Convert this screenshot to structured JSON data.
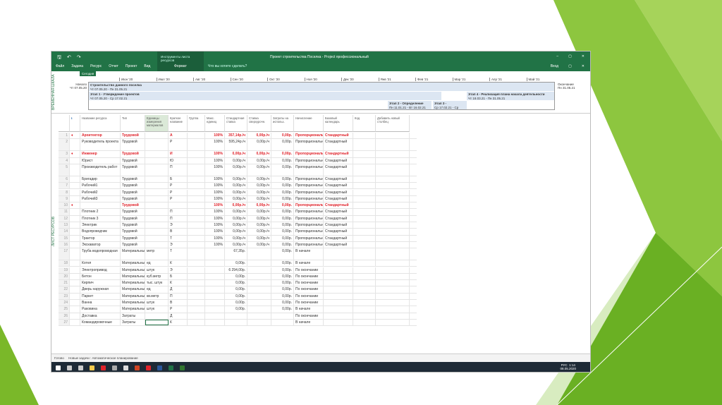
{
  "app": {
    "title": "Проект строительства Поселка - Project профессиональный",
    "context_tab_group": "Инструменты листа ресурсов",
    "context_tab": "Формат",
    "tell_me": "Что вы хотите сделать?",
    "sign_in": "Вход"
  },
  "menu": [
    "Файл",
    "Задача",
    "Ресурс",
    "Отчет",
    "Проект",
    "Вид"
  ],
  "timeline": {
    "label": "ВРЕМЕННАЯ ШКАЛА",
    "today": "Сегодня",
    "start_label": "Начало",
    "start_date": "Чт 07.05.20",
    "end_label": "Окончание",
    "end_date": "Пн 31.05.21",
    "months": [
      "Июн '20",
      "Июл '20",
      "Авг '20",
      "Сен '20",
      "Окт '20",
      "Ноя '20",
      "Дек '20",
      "Янв '21",
      "Фев '21",
      "Мар '21",
      "Апр '21",
      "Май '21"
    ],
    "bars": [
      {
        "name": "Строительство данного поселка",
        "dates": "Чт 07.05.20 - Пн 31.05.21"
      },
      {
        "name": "Этап 1 - Утверждение проектов",
        "dates": "Чт 07.05.20 - Ср 17.02.21"
      },
      {
        "name": "Этап 4 - Реализация плана начала деятельности",
        "dates": "Чт 18.03.21 - Пн 31.05.21"
      },
      {
        "name": "Этап 2 - Определение",
        "dates": "Пн 11.01.21 - Вт 16.02.21"
      },
      {
        "name": "Этап 3 -",
        "dates": "Ср 17.02.21 - Ср"
      }
    ]
  },
  "sheet_label": "ЛИСТ РЕСУРСОВ",
  "columns": [
    "",
    "Название ресурса",
    "Тип",
    "Единицы измерения материалов",
    "Краткое название",
    "Группа",
    "Макс. единиц",
    "Стандартная ставка",
    "Ставка сверхурочн.",
    "Затраты на использ.",
    "Начисление",
    "Базовый календарь",
    "Код",
    "Добавить новый столбец"
  ],
  "rows": [
    {
      "n": "1",
      "ind": true,
      "name": "Архитектор",
      "type": "Трудовой",
      "unit": "",
      "ini": "А",
      "max": "100%",
      "std": "357,14р./ч",
      "ovt": "0,00р./ч",
      "cost": "0,00р.",
      "acc": "Пропорционально",
      "cal": "Стандартный",
      "red": true
    },
    {
      "n": "2",
      "name": "Руководитель проекта",
      "type": "Трудовой",
      "unit": "",
      "ini": "Р",
      "max": "100%",
      "std": "595,24р./ч",
      "ovt": "0,00р./ч",
      "cost": "0,00р.",
      "acc": "Пропорционально",
      "cal": "Стандартный",
      "tall": true
    },
    {
      "n": "3",
      "ind": true,
      "name": "Инженер",
      "type": "Трудовой",
      "unit": "",
      "ini": "И",
      "max": "100%",
      "std": "0,00р./ч",
      "ovt": "0,00р./ч",
      "cost": "0,00р.",
      "acc": "Пропорционально",
      "cal": "Стандартный",
      "red": true
    },
    {
      "n": "4",
      "name": "Юрист",
      "type": "Трудовой",
      "unit": "",
      "ini": "Ю",
      "max": "100%",
      "std": "0,00р./ч",
      "ovt": "0,00р./ч",
      "cost": "0,00р.",
      "acc": "Пропорционально",
      "cal": "Стандартный"
    },
    {
      "n": "5",
      "name": "Производитель работ",
      "type": "Трудовой",
      "unit": "",
      "ini": "П",
      "max": "100%",
      "std": "0,00р./ч",
      "ovt": "0,00р./ч",
      "cost": "0,00р.",
      "acc": "Пропорционально",
      "cal": "Стандартный",
      "tall": true
    },
    {
      "n": "6",
      "name": "Бригадир",
      "type": "Трудовой",
      "unit": "",
      "ini": "Б",
      "max": "100%",
      "std": "0,00р./ч",
      "ovt": "0,00р./ч",
      "cost": "0,00р.",
      "acc": "Пропорционально",
      "cal": "Стандартный"
    },
    {
      "n": "7",
      "name": "Рабочий1",
      "type": "Трудовой",
      "unit": "",
      "ini": "Р",
      "max": "100%",
      "std": "0,00р./ч",
      "ovt": "0,00р./ч",
      "cost": "0,00р.",
      "acc": "Пропорционально",
      "cal": "Стандартный"
    },
    {
      "n": "8",
      "name": "Рабочий2",
      "type": "Трудовой",
      "unit": "",
      "ini": "Р",
      "max": "100%",
      "std": "0,00р./ч",
      "ovt": "0,00р./ч",
      "cost": "0,00р.",
      "acc": "Пропорционально",
      "cal": "Стандартный"
    },
    {
      "n": "9",
      "name": "Рабочий3",
      "type": "Трудовой",
      "unit": "",
      "ini": "Р",
      "max": "100%",
      "std": "0,00р./ч",
      "ovt": "0,00р./ч",
      "cost": "0,00р.",
      "acc": "Пропорционально",
      "cal": "Стандартный"
    },
    {
      "n": "10",
      "ind": true,
      "name": "",
      "type": "Трудовой",
      "unit": "",
      "ini": "",
      "max": "100%",
      "std": "0,00р./ч",
      "ovt": "0,00р./ч",
      "cost": "0,00р.",
      "acc": "Пропорционально",
      "cal": "Стандартный",
      "red": true
    },
    {
      "n": "11",
      "name": "Плотник 2",
      "type": "Трудовой",
      "unit": "",
      "ini": "П",
      "max": "100%",
      "std": "0,00р./ч",
      "ovt": "0,00р./ч",
      "cost": "0,00р.",
      "acc": "Пропорционально",
      "cal": "Стандартный"
    },
    {
      "n": "12",
      "name": "Плотник 3",
      "type": "Трудовой",
      "unit": "",
      "ini": "П",
      "max": "100%",
      "std": "0,00р./ч",
      "ovt": "0,00р./ч",
      "cost": "0,00р.",
      "acc": "Пропорционально",
      "cal": "Стандартный"
    },
    {
      "n": "13",
      "name": "Электрик",
      "type": "Трудовой",
      "unit": "",
      "ini": "Э",
      "max": "100%",
      "std": "0,00р./ч",
      "ovt": "0,00р./ч",
      "cost": "0,00р.",
      "acc": "Пропорционально",
      "cal": "Стандартный"
    },
    {
      "n": "14",
      "name": "Водопроводчик",
      "type": "Трудовой",
      "unit": "",
      "ini": "В",
      "max": "100%",
      "std": "0,00р./ч",
      "ovt": "0,00р./ч",
      "cost": "0,00р.",
      "acc": "Пропорционально",
      "cal": "Стандартный"
    },
    {
      "n": "15",
      "name": "Трактор",
      "type": "Трудовой",
      "unit": "",
      "ini": "Т",
      "max": "100%",
      "std": "0,00р./ч",
      "ovt": "0,00р./ч",
      "cost": "0,00р.",
      "acc": "Пропорционально",
      "cal": "Стандартный"
    },
    {
      "n": "16",
      "name": "Экскаватор",
      "type": "Трудовой",
      "unit": "",
      "ini": "Э",
      "max": "100%",
      "std": "0,00р./ч",
      "ovt": "0,00р./ч",
      "cost": "0,00р.",
      "acc": "Пропорционально",
      "cal": "Стандартный"
    },
    {
      "n": "17",
      "name": "Труба водопроводная",
      "type": "Материальный",
      "unit": "метр",
      "ini": "Т",
      "max": "",
      "std": "67,35р.",
      "ovt": "",
      "cost": "0,00р.",
      "acc": "В начале",
      "cal": "",
      "tall": true
    },
    {
      "n": "18",
      "name": "Котел",
      "type": "Материальный",
      "unit": "ед",
      "ini": "К",
      "max": "",
      "std": "0,00р.",
      "ovt": "",
      "cost": "0,00р.",
      "acc": "В начале",
      "cal": ""
    },
    {
      "n": "19",
      "name": "Электропривод",
      "type": "Материальный",
      "unit": "штук",
      "ini": "Э",
      "max": "",
      "std": "6 294,00р.",
      "ovt": "",
      "cost": "0,00р.",
      "acc": "По окончании",
      "cal": ""
    },
    {
      "n": "20",
      "name": "Бетон",
      "type": "Материальный",
      "unit": "куб.метр",
      "ini": "Б",
      "max": "",
      "std": "0,00р.",
      "ovt": "",
      "cost": "0,00р.",
      "acc": "По окончании",
      "cal": ""
    },
    {
      "n": "21",
      "name": "Кирпич",
      "type": "Материальный",
      "unit": "тыс. штук",
      "ini": "К",
      "max": "",
      "std": "0,00р.",
      "ovt": "",
      "cost": "0,00р.",
      "acc": "По окончании",
      "cal": ""
    },
    {
      "n": "22",
      "name": "Дверь наружная",
      "type": "Материальный",
      "unit": "ед",
      "ini": "Д",
      "max": "",
      "std": "0,00р.",
      "ovt": "",
      "cost": "0,00р.",
      "acc": "По окончании",
      "cal": ""
    },
    {
      "n": "23",
      "name": "Паркет",
      "type": "Материальный",
      "unit": "кв.метр",
      "ini": "П",
      "max": "",
      "std": "0,00р.",
      "ovt": "",
      "cost": "0,00р.",
      "acc": "По окончании",
      "cal": ""
    },
    {
      "n": "24",
      "name": "Ванна",
      "type": "Материальный",
      "unit": "штук",
      "ini": "В",
      "max": "",
      "std": "0,00р.",
      "ovt": "",
      "cost": "0,00р.",
      "acc": "По окончании",
      "cal": ""
    },
    {
      "n": "25",
      "name": "Раковина",
      "type": "Материальный",
      "unit": "штук",
      "ini": "Р",
      "max": "",
      "std": "0,00р.",
      "ovt": "",
      "cost": "0,00р.",
      "acc": "В начале",
      "cal": ""
    },
    {
      "n": "26",
      "name": "Доставка",
      "type": "Затраты",
      "unit": "",
      "ini": "Д",
      "max": "",
      "std": "",
      "ovt": "",
      "cost": "",
      "acc": "По окончании",
      "cal": ""
    },
    {
      "n": "27",
      "name": "Командировочные",
      "type": "Затраты",
      "unit": "",
      "ini": "К",
      "max": "",
      "std": "",
      "ovt": "",
      "cost": "",
      "acc": "В начале",
      "cal": ""
    }
  ],
  "status": {
    "ready": "Готово",
    "mode": "Новые задачи : Автоматическое планирование"
  },
  "taskbar": {
    "lang": "РУС",
    "time": "1:14",
    "date": "08.05.2020",
    "icons": [
      "windows-icon",
      "search-icon",
      "task-view-icon",
      "explorer-icon",
      "opera-icon",
      "app-icon",
      "calculator-icon",
      "powerpoint-icon",
      "acrobat-icon",
      "word-icon",
      "excel-icon",
      "project-icon"
    ]
  },
  "colors": {
    "accent": "#217346",
    "red": "#e0232b",
    "slide_green": "#8dc63f"
  }
}
